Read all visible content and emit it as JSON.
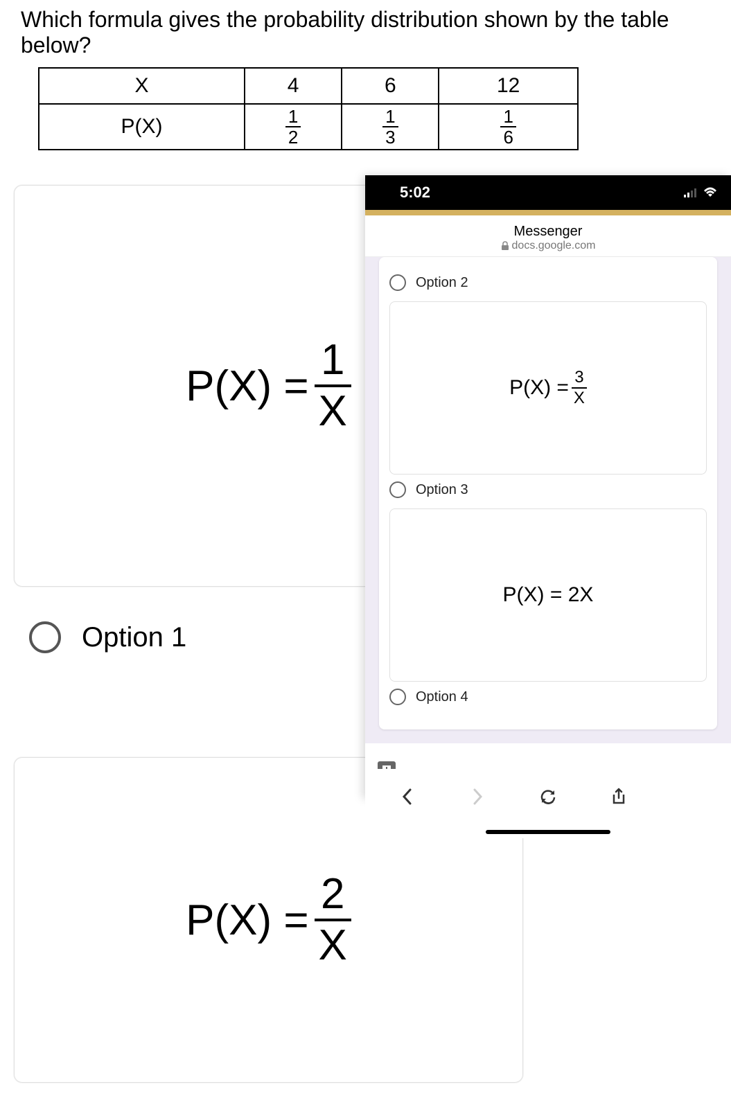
{
  "question": "Which formula gives the probability distribution shown by the table below?",
  "table": {
    "row1": {
      "header": "X",
      "c1": "4",
      "c2": "6",
      "c3": "12"
    },
    "row2": {
      "header": "P(X)",
      "c1n": "1",
      "c1d": "2",
      "c2n": "1",
      "c2d": "3",
      "c3n": "1",
      "c3d": "6"
    }
  },
  "option1": {
    "label": "Option 1",
    "formula_left": "P(X) = ",
    "num": "1",
    "den": "X"
  },
  "option2_card": {
    "formula_left": "P(X) = ",
    "num": "2",
    "den": "X"
  },
  "phone": {
    "time": "5:02",
    "header_title": "Messenger",
    "header_sub": "docs.google.com",
    "opt2": {
      "label": "Option 2"
    },
    "opt3_card": {
      "left": "P(X) = ",
      "num": "3",
      "den": "X"
    },
    "opt3": {
      "label": "Option 3"
    },
    "opt4_card": {
      "formula": "P(X) = 2X"
    },
    "opt4": {
      "label": "Option 4"
    }
  }
}
